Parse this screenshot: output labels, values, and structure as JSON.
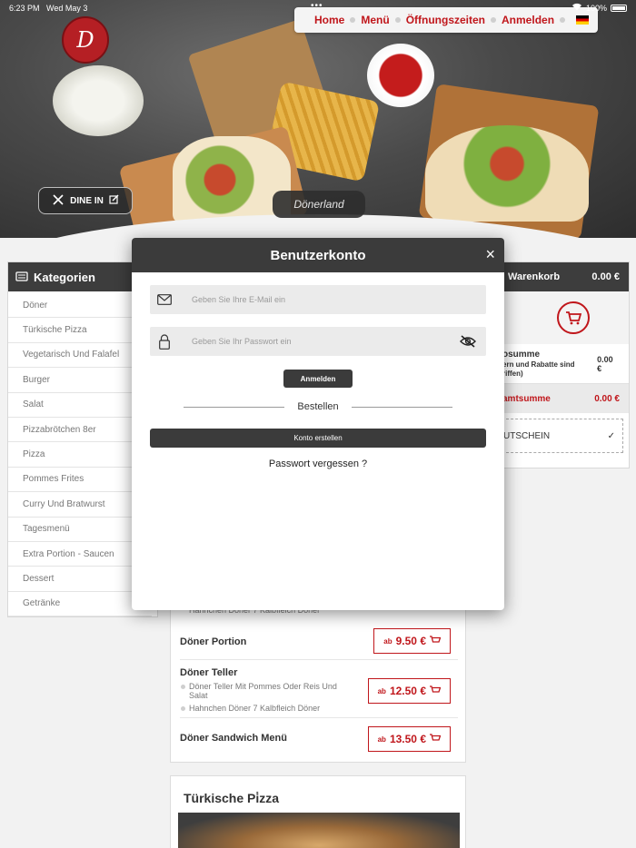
{
  "status": {
    "time": "6:23 PM",
    "date": "Wed May 3",
    "battery": "100%"
  },
  "nav": {
    "home": "Home",
    "menu": "Menü",
    "hours": "Öffnungszeiten",
    "login": "Anmelden",
    "language_icon": "german-flag-icon"
  },
  "hero": {
    "logo_text": "D",
    "dine_in": "DINE IN",
    "restaurant": "Dönerland"
  },
  "categories": {
    "title": "Kategorien",
    "items": [
      "Döner",
      "Türkische Pizza",
      "Vegetarisch Und Falafel",
      "Burger",
      "Salat",
      "Pizzabrötchen 8er",
      "Pizza",
      "Pommes Frites",
      "Curry Und Bratwurst",
      "Tagesmenü",
      "Extra Portion - Saucen",
      "Dessert",
      "Getränke"
    ]
  },
  "cart": {
    "title": "Warenkorb",
    "amount": "0.00 €",
    "subtotal_label": "osumme",
    "subtotal_note": "ern und Rabatte sind riffen)",
    "subtotal_value": "0.00 €",
    "total_label": "amtsumme",
    "total_value": "0.00 €",
    "voucher": "UTSCHEIN",
    "check": "✓"
  },
  "menu": {
    "partial_line": "Hahnchen Döner 7 Kalbfleich Döner",
    "items": [
      {
        "name": "Döner Portion",
        "ab": "ab",
        "price": "9.50 €"
      },
      {
        "name": "Döner Teller",
        "desc1": "Döner Teller Mit Pommes Oder Reis Und Salat",
        "desc2": "Hahnchen Döner 7 Kalbfleich Döner",
        "ab": "ab",
        "price": "12.50 €"
      },
      {
        "name": "Döner Sandwich Menü",
        "ab": "ab",
        "price": "13.50 €"
      }
    ],
    "next_section": "Türkische Pi̇zza"
  },
  "modal": {
    "title": "Benutzerkonto",
    "close": "×",
    "email_placeholder": "Geben Sie Ihre E-Mail ein",
    "password_placeholder": "Geben Sie Ihr Passwort ein",
    "login_button": "Anmelden",
    "divider_text": "Bestellen",
    "create_button": "Konto erstellen",
    "forgot": "Passwort vergessen ?"
  },
  "colors": {
    "accent": "#c0161b",
    "dark": "#3b3b3b"
  }
}
